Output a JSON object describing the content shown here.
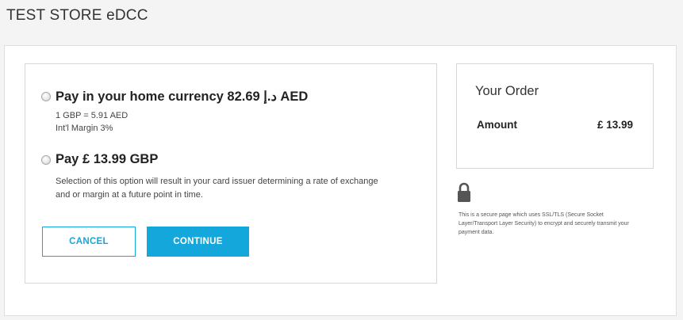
{
  "header": {
    "title": "TEST STORE eDCC"
  },
  "options": {
    "home_currency": {
      "heading": "Pay in your home currency 82.69 د.إ AED",
      "rate": "1 GBP = 5.91 AED",
      "margin": "Int'l Margin 3%"
    },
    "card_currency": {
      "heading": "Pay £ 13.99 GBP",
      "description": "Selection of this option will result in your card issuer determining a rate of exchange and or margin at a future point in time."
    }
  },
  "buttons": {
    "cancel": "CANCEL",
    "continue": "CONTINUE"
  },
  "order": {
    "title": "Your Order",
    "amount_label": "Amount",
    "amount_value": "£ 13.99"
  },
  "security": {
    "icon": "lock-icon",
    "note": "This is a secure page which uses SSL/TLS (Secure Socket Layer/Transport Layer Security) to encrypt and securely transmit your payment data."
  },
  "colors": {
    "accent": "#14a7db",
    "page_bg": "#f4f4f4",
    "border": "#d7d7d7"
  }
}
